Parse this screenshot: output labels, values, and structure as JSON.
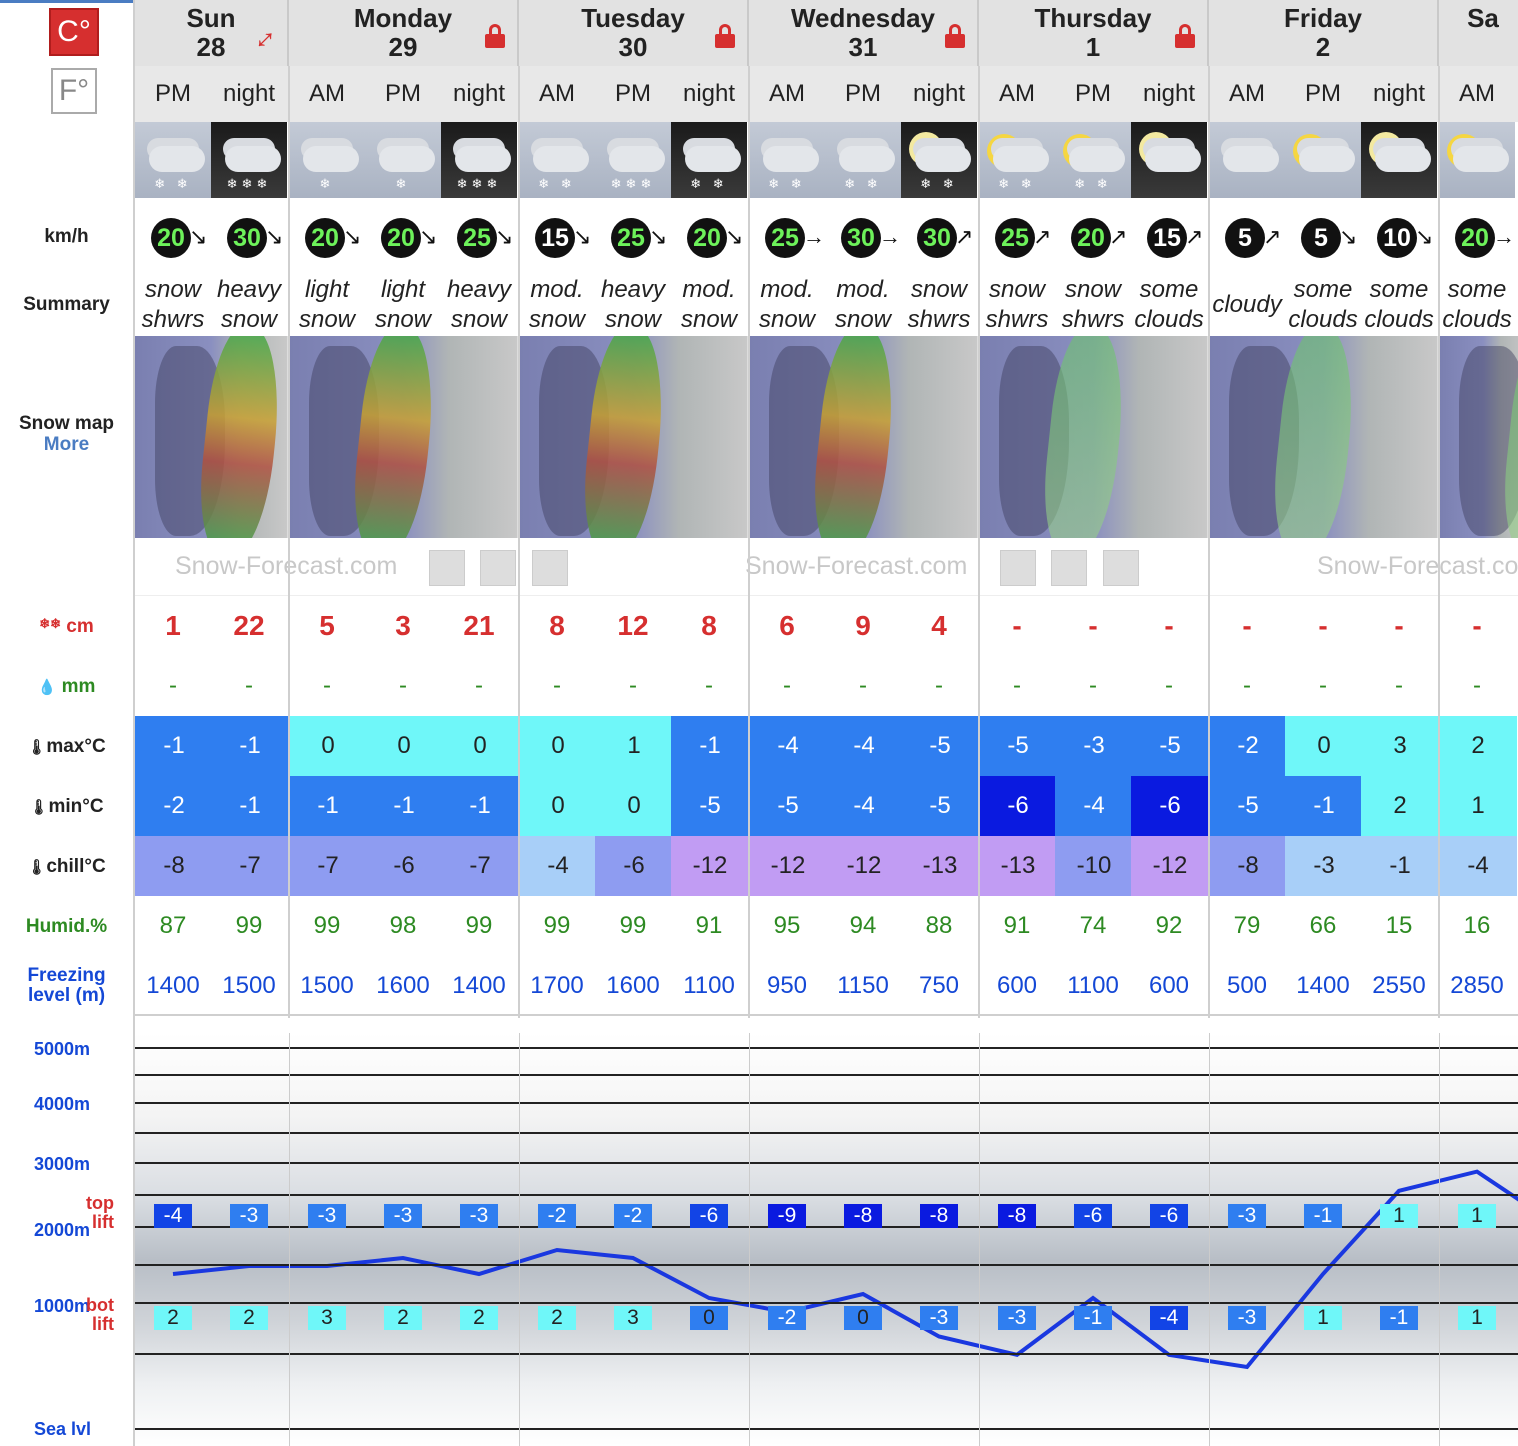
{
  "units": {
    "celsius": "C°",
    "fahrenheit": "F°"
  },
  "labels": {
    "wind": "km/h",
    "summary": "Summary",
    "snowmap": "Snow map",
    "more": "More",
    "snow": "cm",
    "rain": "mm",
    "max": "max°C",
    "min": "min°C",
    "chill": "chill°C",
    "humid": "Humid.%",
    "freeze_line1": "Freezing",
    "freeze_line2": "level (m)",
    "top_lift_1": "top",
    "top_lift_2": "lift",
    "bot_lift_1": "bot",
    "bot_lift_2": "lift",
    "alt_5000": "5000m",
    "alt_4000": "4000m",
    "alt_3000": "3000m",
    "alt_2000": "2000m",
    "alt_1000": "1000m",
    "alt_sea": "Sea lvl"
  },
  "brand": "Snow-Forecast.com",
  "brand_cut": "Snow-Forecast.co",
  "days": [
    {
      "name": "Sun",
      "date": "28",
      "icon": "expand-icon"
    },
    {
      "name": "Monday",
      "date": "29",
      "icon": "lock-icon"
    },
    {
      "name": "Tuesday",
      "date": "30",
      "icon": "lock-icon"
    },
    {
      "name": "Wednesday",
      "date": "31",
      "icon": "lock-icon"
    },
    {
      "name": "Thursday",
      "date": "1",
      "icon": "lock-icon"
    },
    {
      "name": "Friday",
      "date": "2",
      "icon": ""
    },
    {
      "name": "Sa",
      "date": "",
      "icon": ""
    }
  ],
  "periods": [
    {
      "p": "PM",
      "wx": "day",
      "lum": "snow",
      "flakes": "❄ ❄",
      "wind": "20",
      "wdir": "↘",
      "wcol": "#6df25a",
      "sum1": "snow",
      "sum2": "shwrs",
      "snow": "1",
      "rain": "-",
      "max": "-1",
      "min": "-2",
      "chill": "-8",
      "humid": "87",
      "freeze": "1400",
      "top": "-4",
      "bot": "2"
    },
    {
      "p": "night",
      "wx": "night",
      "lum": "snow",
      "flakes": "❄❄❄",
      "wind": "30",
      "wdir": "↘",
      "wcol": "#6df25a",
      "sum1": "heavy",
      "sum2": "snow",
      "snow": "22",
      "rain": "-",
      "max": "-1",
      "min": "-1",
      "chill": "-7",
      "humid": "99",
      "freeze": "1500",
      "top": "-3",
      "bot": "2"
    },
    {
      "p": "AM",
      "wx": "day",
      "lum": "snow",
      "flakes": "❄",
      "wind": "20",
      "wdir": "↘",
      "wcol": "#6df25a",
      "sum1": "light",
      "sum2": "snow",
      "snow": "5",
      "rain": "-",
      "max": "0",
      "min": "-1",
      "chill": "-7",
      "humid": "99",
      "freeze": "1500",
      "top": "-3",
      "bot": "3"
    },
    {
      "p": "PM",
      "wx": "day",
      "lum": "snow",
      "flakes": "❄",
      "wind": "20",
      "wdir": "↘",
      "wcol": "#6df25a",
      "sum1": "light",
      "sum2": "snow",
      "snow": "3",
      "rain": "-",
      "max": "0",
      "min": "-1",
      "chill": "-6",
      "humid": "98",
      "freeze": "1600",
      "top": "-3",
      "bot": "2"
    },
    {
      "p": "night",
      "wx": "night",
      "lum": "snow",
      "flakes": "❄❄❄",
      "wind": "25",
      "wdir": "↘",
      "wcol": "#6df25a",
      "sum1": "heavy",
      "sum2": "snow",
      "snow": "21",
      "rain": "-",
      "max": "0",
      "min": "-1",
      "chill": "-7",
      "humid": "99",
      "freeze": "1400",
      "top": "-3",
      "bot": "2"
    },
    {
      "p": "AM",
      "wx": "day",
      "lum": "snow",
      "flakes": "❄ ❄",
      "wind": "15",
      "wdir": "↘",
      "wcol": "#ffffff",
      "sum1": "mod.",
      "sum2": "snow",
      "snow": "8",
      "rain": "-",
      "max": "0",
      "min": "0",
      "chill": "-4",
      "humid": "99",
      "freeze": "1700",
      "top": "-2",
      "bot": "2"
    },
    {
      "p": "PM",
      "wx": "day",
      "lum": "snow",
      "flakes": "❄❄❄",
      "wind": "25",
      "wdir": "↘",
      "wcol": "#6df25a",
      "sum1": "heavy",
      "sum2": "snow",
      "snow": "12",
      "rain": "-",
      "max": "1",
      "min": "0",
      "chill": "-6",
      "humid": "99",
      "freeze": "1600",
      "top": "-2",
      "bot": "3"
    },
    {
      "p": "night",
      "wx": "night",
      "lum": "snow",
      "flakes": "❄ ❄",
      "wind": "20",
      "wdir": "↘",
      "wcol": "#6df25a",
      "sum1": "mod.",
      "sum2": "snow",
      "snow": "8",
      "rain": "-",
      "max": "-1",
      "min": "-5",
      "chill": "-12",
      "humid": "91",
      "freeze": "1100",
      "top": "-6",
      "bot": "0"
    },
    {
      "p": "AM",
      "wx": "day",
      "lum": "snow",
      "flakes": "❄ ❄",
      "wind": "25",
      "wdir": "→",
      "wcol": "#6df25a",
      "sum1": "mod.",
      "sum2": "snow",
      "snow": "6",
      "rain": "-",
      "max": "-4",
      "min": "-5",
      "chill": "-12",
      "humid": "95",
      "freeze": "950",
      "top": "-9",
      "bot": "-2"
    },
    {
      "p": "PM",
      "wx": "day",
      "lum": "snow",
      "flakes": "❄ ❄",
      "wind": "30",
      "wdir": "→",
      "wcol": "#6df25a",
      "sum1": "mod.",
      "sum2": "snow",
      "snow": "9",
      "rain": "-",
      "max": "-4",
      "min": "-4",
      "chill": "-12",
      "humid": "94",
      "freeze": "1150",
      "top": "-8",
      "bot": "0"
    },
    {
      "p": "night",
      "wx": "night",
      "lum": "moon",
      "flakes": "❄ ❄",
      "wind": "30",
      "wdir": "↗",
      "wcol": "#6df25a",
      "sum1": "snow",
      "sum2": "shwrs",
      "snow": "4",
      "rain": "-",
      "max": "-5",
      "min": "-5",
      "chill": "-13",
      "humid": "88",
      "freeze": "750",
      "top": "-8",
      "bot": "-3"
    },
    {
      "p": "AM",
      "wx": "day",
      "lum": "sun",
      "flakes": "❄ ❄",
      "wind": "25",
      "wdir": "↗",
      "wcol": "#6df25a",
      "sum1": "snow",
      "sum2": "shwrs",
      "snow": "-",
      "rain": "-",
      "max": "-5",
      "min": "-6",
      "chill": "-13",
      "humid": "91",
      "freeze": "600",
      "top": "-8",
      "bot": "-3"
    },
    {
      "p": "PM",
      "wx": "day",
      "lum": "sun",
      "flakes": "❄ ❄",
      "wind": "20",
      "wdir": "↗",
      "wcol": "#6df25a",
      "sum1": "snow",
      "sum2": "shwrs",
      "snow": "-",
      "rain": "-",
      "max": "-3",
      "min": "-4",
      "chill": "-10",
      "humid": "74",
      "freeze": "1100",
      "top": "-6",
      "bot": "-1"
    },
    {
      "p": "night",
      "wx": "night",
      "lum": "moon",
      "flakes": "",
      "wind": "15",
      "wdir": "↗",
      "wcol": "#ffffff",
      "sum1": "some",
      "sum2": "clouds",
      "snow": "-",
      "rain": "-",
      "max": "-5",
      "min": "-6",
      "chill": "-12",
      "humid": "92",
      "freeze": "600",
      "top": "-6",
      "bot": "-4"
    },
    {
      "p": "AM",
      "wx": "day",
      "lum": "none",
      "flakes": "",
      "wind": "5",
      "wdir": "↗",
      "wcol": "#ffffff",
      "sum1": "cloudy",
      "sum2": "",
      "snow": "-",
      "rain": "-",
      "max": "-2",
      "min": "-5",
      "chill": "-8",
      "humid": "79",
      "freeze": "500",
      "top": "-3",
      "bot": "-3"
    },
    {
      "p": "PM",
      "wx": "day",
      "lum": "sun",
      "flakes": "",
      "wind": "5",
      "wdir": "↘",
      "wcol": "#ffffff",
      "sum1": "some",
      "sum2": "clouds",
      "snow": "-",
      "rain": "-",
      "max": "0",
      "min": "-1",
      "chill": "-3",
      "humid": "66",
      "freeze": "1400",
      "top": "-1",
      "bot": "1"
    },
    {
      "p": "night",
      "wx": "night",
      "lum": "moon",
      "flakes": "",
      "wind": "10",
      "wdir": "↘",
      "wcol": "#ffffff",
      "sum1": "some",
      "sum2": "clouds",
      "snow": "-",
      "rain": "-",
      "max": "3",
      "min": "2",
      "chill": "-1",
      "humid": "15",
      "freeze": "2550",
      "top": "1",
      "bot": "-1"
    },
    {
      "p": "AM",
      "wx": "day",
      "lum": "sun",
      "flakes": "",
      "wind": "20",
      "wdir": "→",
      "wcol": "#6df25a",
      "sum1": "some",
      "sum2": "clouds",
      "snow": "-",
      "rain": "-",
      "max": "2",
      "min": "1",
      "chill": "-4",
      "humid": "16",
      "freeze": "2850",
      "top": "1",
      "bot": "1"
    }
  ],
  "colors": {
    "accent_red": "#d62f2f",
    "temp_cyan": "#6ff7f9",
    "temp_blue": "#2f7ef0",
    "temp_darkblue": "#1244e6",
    "temp_navy": "#0a1ae0",
    "chill_lightblue": "#a8cff8",
    "chill_periwinkle": "#8e9cf1",
    "chill_lavender": "#c19cf3",
    "freeze_line": "#1a38e0"
  }
}
